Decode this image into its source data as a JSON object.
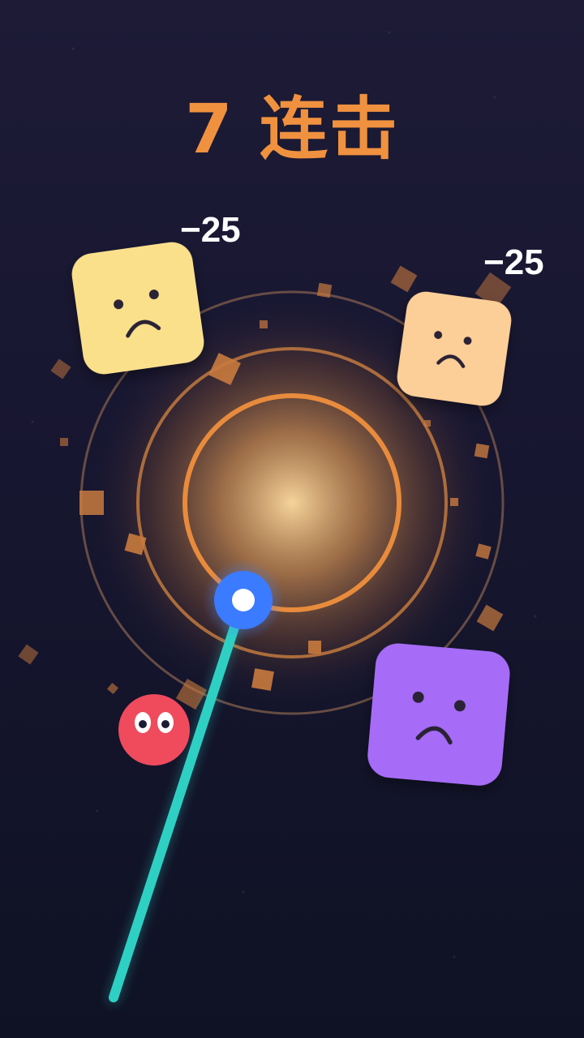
{
  "hud": {
    "combo_text": "7 连击",
    "combo_color": "#f0913f"
  },
  "damage_popups": [
    "−25",
    "−25"
  ],
  "enemies": [
    {
      "name": "yellow-block",
      "color": "#fbe08c",
      "mood": "sad"
    },
    {
      "name": "peach-block",
      "color": "#fdcf98",
      "mood": "sad"
    },
    {
      "name": "purple-block",
      "color": "#a66cf7",
      "mood": "sad"
    }
  ],
  "player_ball": {
    "color": "#f04a5d"
  },
  "aim_line": {
    "color": "#2fd0c4"
  },
  "launcher_orb": {
    "color": "#3b7bff"
  },
  "core": {
    "glow_color": "#f5c98a",
    "ring_color": "#e88b3c"
  }
}
